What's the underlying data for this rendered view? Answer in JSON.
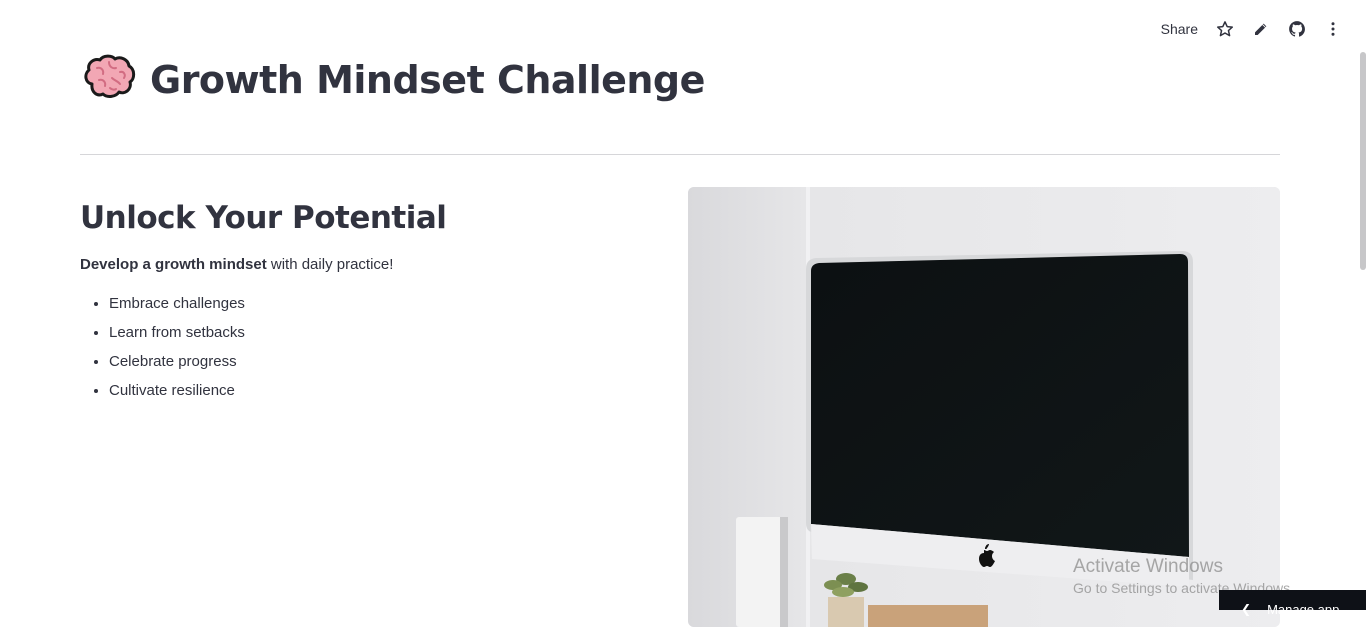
{
  "toolbar": {
    "share_label": "Share",
    "icons": [
      "star-icon",
      "pencil-icon",
      "github-icon",
      "kebab-menu-icon"
    ]
  },
  "header": {
    "emoji": "brain-icon",
    "title": "Growth Mindset Challenge"
  },
  "main": {
    "subheading": "Unlock Your Potential",
    "intro_bold": "Develop a growth mindset",
    "intro_rest": " with daily practice!",
    "points": [
      "Embrace challenges",
      "Learn from setbacks",
      "Celebrate progress",
      "Cultivate resilience"
    ]
  },
  "image": {
    "subject": "desktop-computer-photo"
  },
  "os_overlay": {
    "watermark_title": "Activate Windows",
    "watermark_sub": "Go to Settings to activate Windows.",
    "manage_app_label": "Manage app"
  },
  "colors": {
    "text": "#31333f",
    "divider": "#d6d6d9",
    "manage_bg": "#0e1117"
  }
}
